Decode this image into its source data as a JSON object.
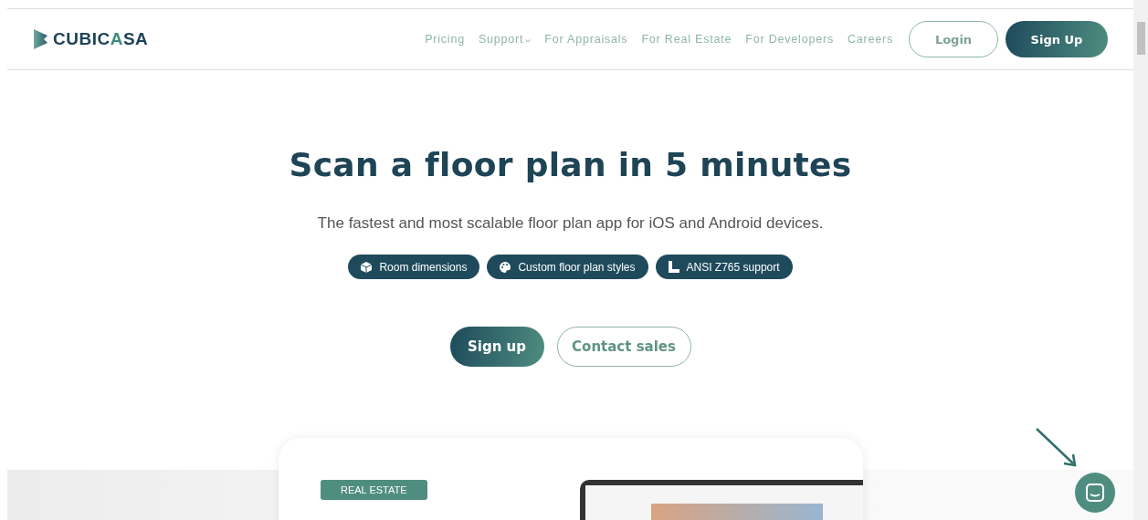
{
  "header": {
    "logo_parts": [
      "CUBIC",
      "A",
      "SA"
    ],
    "nav": [
      {
        "label": "Pricing",
        "dropdown": false
      },
      {
        "label": "Support",
        "dropdown": true
      },
      {
        "label": "For Appraisals",
        "dropdown": false
      },
      {
        "label": "For Real Estate",
        "dropdown": false
      },
      {
        "label": "For Developers",
        "dropdown": false
      },
      {
        "label": "Careers",
        "dropdown": false
      }
    ],
    "buttons": [
      {
        "label": "Login",
        "kind": "outline"
      },
      {
        "label": "Sign Up",
        "kind": "filled"
      }
    ]
  },
  "hero": {
    "title": "Scan a floor plan in 5 minutes",
    "subtitle": "The fastest and most scalable floor plan app for iOS and Android devices.",
    "features": [
      {
        "label": "Room dimensions",
        "kind": "cube"
      },
      {
        "label": "Custom floor plan styles",
        "kind": "palette"
      },
      {
        "label": "ANSI Z765 support",
        "kind": "ruler"
      }
    ],
    "buttons": [
      {
        "label": "Sign up",
        "kind": "filled"
      },
      {
        "label": "Contact sales",
        "kind": "outline"
      }
    ]
  },
  "card": {
    "tag": "REAL ESTATE"
  }
}
